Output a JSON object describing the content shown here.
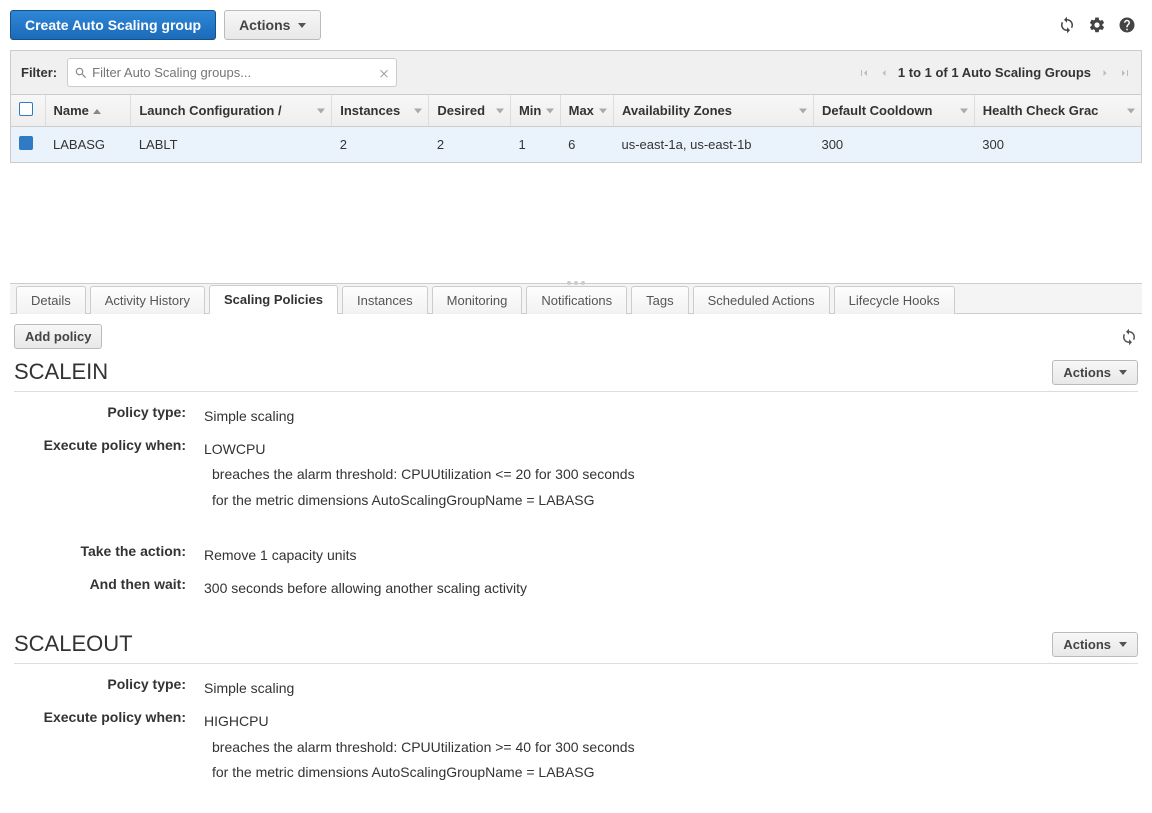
{
  "toolbar": {
    "create_label": "Create Auto Scaling group",
    "actions_label": "Actions"
  },
  "filter": {
    "label": "Filter:",
    "placeholder": "Filter Auto Scaling groups..."
  },
  "pagination": {
    "text": "1 to 1 of 1 Auto Scaling Groups"
  },
  "columns": {
    "name": "Name",
    "launch_config": "Launch Configuration /",
    "instances": "Instances",
    "desired": "Desired",
    "min": "Min",
    "max": "Max",
    "az": "Availability Zones",
    "cooldown": "Default Cooldown",
    "health": "Health Check Grac"
  },
  "row": {
    "name": "LABASG",
    "launch_config": "LABLT",
    "instances": "2",
    "desired": "2",
    "min": "1",
    "max": "6",
    "az": "us-east-1a, us-east-1b",
    "cooldown": "300",
    "health": "300"
  },
  "tabs": {
    "details": "Details",
    "activity": "Activity History",
    "scaling": "Scaling Policies",
    "instances": "Instances",
    "monitoring": "Monitoring",
    "notifications": "Notifications",
    "tags": "Tags",
    "scheduled": "Scheduled Actions",
    "lifecycle": "Lifecycle Hooks"
  },
  "panel": {
    "add_policy": "Add policy",
    "actions": "Actions",
    "labels": {
      "policy_type": "Policy type:",
      "execute_when": "Execute policy when:",
      "take_action": "Take the action:",
      "and_wait": "And then wait:"
    }
  },
  "policies": [
    {
      "name": "SCALEIN",
      "type": "Simple scaling",
      "alarm": "LOWCPU",
      "breach_line": "breaches the alarm threshold: CPUUtilization <= 20 for 300 seconds",
      "dim_line": "for the metric dimensions AutoScalingGroupName = LABASG",
      "action": "Remove 1 capacity units",
      "wait": "300 seconds before allowing another scaling activity"
    },
    {
      "name": "SCALEOUT",
      "type": "Simple scaling",
      "alarm": "HIGHCPU",
      "breach_line": "breaches the alarm threshold: CPUUtilization >= 40 for 300 seconds",
      "dim_line": "for the metric dimensions AutoScalingGroupName = LABASG",
      "action": "",
      "wait": ""
    }
  ]
}
